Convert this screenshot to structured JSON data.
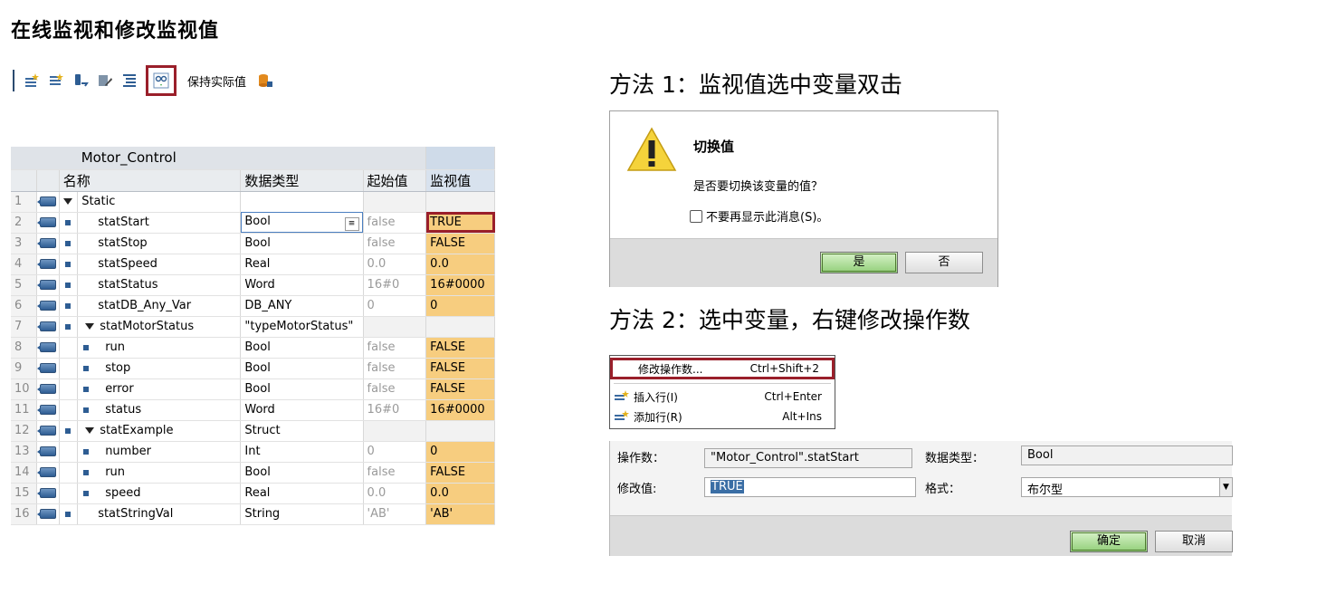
{
  "page_title": "在线监视和修改监视值",
  "toolbar": {
    "keep_actual_label": "保持实际值",
    "icons": [
      "insert-row-icon",
      "add-row-icon",
      "snapshot-icon",
      "copy-snapshot-icon",
      "expand-all-icon",
      "monitor-icon",
      "database-icon"
    ]
  },
  "table": {
    "block_name": "Motor_Control",
    "headers": {
      "name": "名称",
      "data_type": "数据类型",
      "start_value": "起始值",
      "monitor_value": "监视值"
    },
    "rows": [
      {
        "n": "1",
        "name": "Static",
        "indent": 0,
        "bullet": false,
        "expander": true,
        "type": "",
        "start": "",
        "monitor": ""
      },
      {
        "n": "2",
        "name": "statStart",
        "indent": 1,
        "bullet": true,
        "expander": false,
        "type": "Bool",
        "start": "false",
        "monitor": "TRUE"
      },
      {
        "n": "3",
        "name": "statStop",
        "indent": 1,
        "bullet": true,
        "expander": false,
        "type": "Bool",
        "start": "false",
        "monitor": "FALSE"
      },
      {
        "n": "4",
        "name": "statSpeed",
        "indent": 1,
        "bullet": true,
        "expander": false,
        "type": "Real",
        "start": "0.0",
        "monitor": "0.0"
      },
      {
        "n": "5",
        "name": "statStatus",
        "indent": 1,
        "bullet": true,
        "expander": false,
        "type": "Word",
        "start": "16#0",
        "monitor": "16#0000"
      },
      {
        "n": "6",
        "name": "statDB_Any_Var",
        "indent": 1,
        "bullet": true,
        "expander": false,
        "type": "DB_ANY",
        "start": "0",
        "monitor": "0"
      },
      {
        "n": "7",
        "name": "statMotorStatus",
        "indent": 1,
        "bullet": true,
        "expander": true,
        "type": "\"typeMotorStatus\"",
        "start": "",
        "monitor": ""
      },
      {
        "n": "8",
        "name": "run",
        "indent": 2,
        "bullet": true,
        "expander": false,
        "type": "Bool",
        "start": "false",
        "monitor": "FALSE"
      },
      {
        "n": "9",
        "name": "stop",
        "indent": 2,
        "bullet": true,
        "expander": false,
        "type": "Bool",
        "start": "false",
        "monitor": "FALSE"
      },
      {
        "n": "10",
        "name": "error",
        "indent": 2,
        "bullet": true,
        "expander": false,
        "type": "Bool",
        "start": "false",
        "monitor": "FALSE"
      },
      {
        "n": "11",
        "name": "status",
        "indent": 2,
        "bullet": true,
        "expander": false,
        "type": "Word",
        "start": "16#0",
        "monitor": "16#0000"
      },
      {
        "n": "12",
        "name": "statExample",
        "indent": 1,
        "bullet": true,
        "expander": true,
        "type": "Struct",
        "start": "",
        "monitor": ""
      },
      {
        "n": "13",
        "name": "number",
        "indent": 2,
        "bullet": true,
        "expander": false,
        "type": "Int",
        "start": "0",
        "monitor": "0"
      },
      {
        "n": "14",
        "name": "run",
        "indent": 2,
        "bullet": true,
        "expander": false,
        "type": "Bool",
        "start": "false",
        "monitor": "FALSE"
      },
      {
        "n": "15",
        "name": "speed",
        "indent": 2,
        "bullet": true,
        "expander": false,
        "type": "Real",
        "start": "0.0",
        "monitor": "0.0"
      },
      {
        "n": "16",
        "name": "statStringVal",
        "indent": 1,
        "bullet": true,
        "expander": false,
        "type": "String",
        "start": "'AB'",
        "monitor": "'AB'"
      }
    ]
  },
  "method1": {
    "heading": "方法 1：监视值选中变量双击",
    "dialog": {
      "title": "切换值",
      "message": "是否要切换该变量的值？",
      "checkbox_label": "不要再显示此消息(S)。",
      "yes_label": "是",
      "no_label": "否"
    }
  },
  "method2": {
    "heading": "方法 2：选中变量，右键修改操作数",
    "menu": [
      {
        "label": "修改操作数...",
        "shortcut": "Ctrl+Shift+2"
      },
      {
        "label": "插入行(I)",
        "shortcut": "Ctrl+Enter"
      },
      {
        "label": "添加行(R)",
        "shortcut": "Alt+Ins"
      }
    ],
    "modify_dialog": {
      "operand_label": "操作数：",
      "operand_value": "\"Motor_Control\".statStart",
      "data_type_label": "数据类型：",
      "data_type_value": "Bool",
      "modify_value_label": "修改值:",
      "modify_value": "TRUE",
      "format_label": "格式：",
      "format_value": "布尔型",
      "ok_label": "确定",
      "cancel_label": "取消"
    }
  }
}
